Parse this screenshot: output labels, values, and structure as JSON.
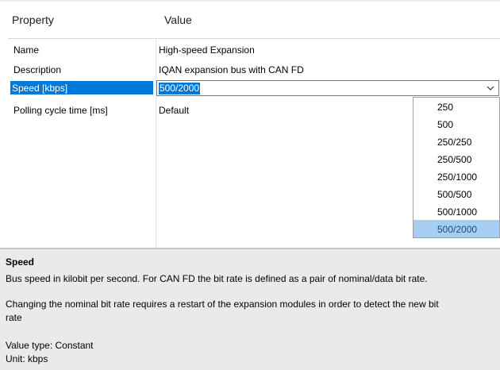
{
  "header": {
    "col_property": "Property",
    "col_value": "Value"
  },
  "rows": [
    {
      "key": "Name",
      "value": "High-speed Expansion"
    },
    {
      "key": "Description",
      "value": "IQAN expansion bus with CAN FD"
    },
    {
      "key": "Speed [kbps]",
      "value": "500/2000"
    },
    {
      "key": "Polling cycle time [ms]",
      "value": "Default"
    }
  ],
  "dropdown": {
    "options": [
      "250",
      "500",
      "250/250",
      "250/500",
      "250/1000",
      "500/500",
      "500/1000",
      "500/2000"
    ],
    "selected": "500/2000"
  },
  "description": {
    "title": "Speed",
    "line1": "Bus speed in kilobit per second. For CAN FD the bit rate is defined as a pair of nominal/data bit rate.",
    "line2": "Changing the nominal bit rate requires a restart of the expansion modules in order to detect the new bit",
    "line3": "rate",
    "line4": "Value type: Constant",
    "line5": "Unit: kbps"
  },
  "colors": {
    "selection": "#0078d7",
    "dropdown_highlight": "#a6cef0",
    "pane_bg": "#eaeaea"
  },
  "icons": {
    "dropdown": "chevron-down-icon"
  }
}
